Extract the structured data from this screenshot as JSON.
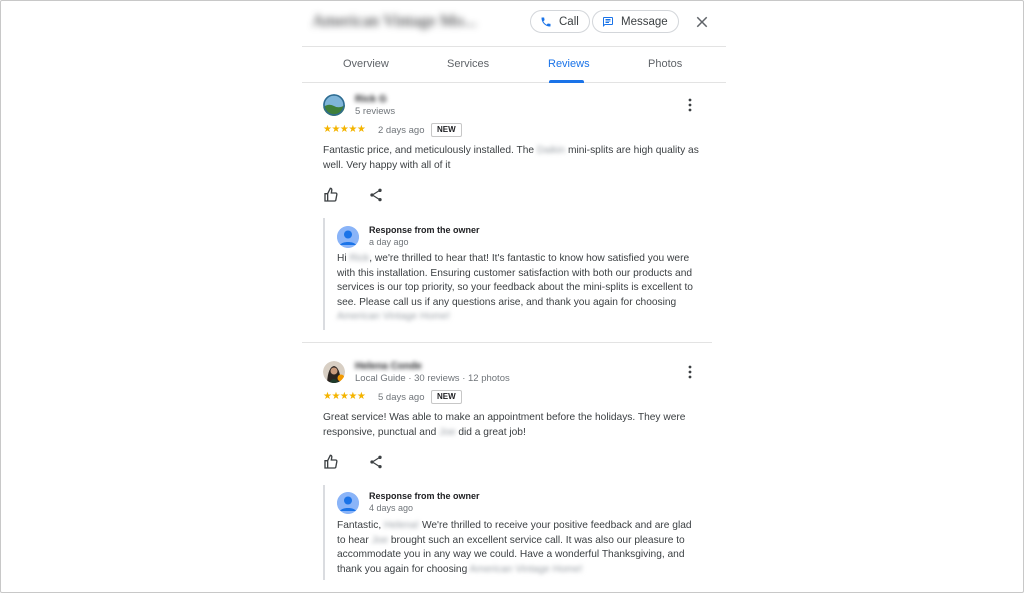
{
  "business": {
    "name": "American Vintage Mo..."
  },
  "header": {
    "call_label": "Call",
    "message_label": "Message"
  },
  "tabs": [
    {
      "label": "Overview"
    },
    {
      "label": "Services"
    },
    {
      "label": "Reviews"
    },
    {
      "label": "Photos"
    }
  ],
  "active_tab": "Reviews",
  "reviews": [
    {
      "name": "Rick G",
      "meta": "5 reviews",
      "stars": "★★★★★",
      "rating": 5,
      "time": "2 days ago",
      "badge": "NEW",
      "text_a": "Fantastic price, and meticulously installed. The ",
      "text_blur": "Daikin",
      "text_b": " mini-splits are high quality as well. Very happy with all of it",
      "owner_title": "Response from the owner",
      "owner_time": "a day ago",
      "owner_a": "Hi ",
      "owner_blur1": "Rick",
      "owner_b": ", we're thrilled to hear that! It's fantastic to know how satisfied you were with this installation. Ensuring customer satisfaction with both our products and services is our top priority, so your feedback about the mini-splits is excellent to see. Please call us if any questions arise, and thank you again for choosing ",
      "owner_blur2": "American Vintage Home!"
    },
    {
      "name": "Helena Conde",
      "meta": "Local Guide · 30 reviews · 12 photos",
      "stars": "★★★★★",
      "rating": 5,
      "time": "5 days ago",
      "badge": "NEW",
      "text_a": "Great service! Was able to make an appointment before the holidays. They were responsive, punctual and ",
      "text_blur": "Joe",
      "text_b": " did a great job!",
      "owner_title": "Response from the owner",
      "owner_time": "4 days ago",
      "owner_a": "Fantastic, ",
      "owner_blur1": "Helena!",
      "owner_b": " We're thrilled to receive your positive feedback and are glad to hear ",
      "owner_blur_mid": "Joe",
      "owner_c": " brought such an excellent service call. It was also our pleasure to accommodate you in any way we could. Have a wonderful Thanksgiving, and thank you again for choosing ",
      "owner_blur2": "American Vintage Home!"
    }
  ],
  "colors": {
    "accent": "#1a73e8",
    "star": "#f4b400",
    "text": "#3c4043",
    "muted": "#70757a"
  }
}
